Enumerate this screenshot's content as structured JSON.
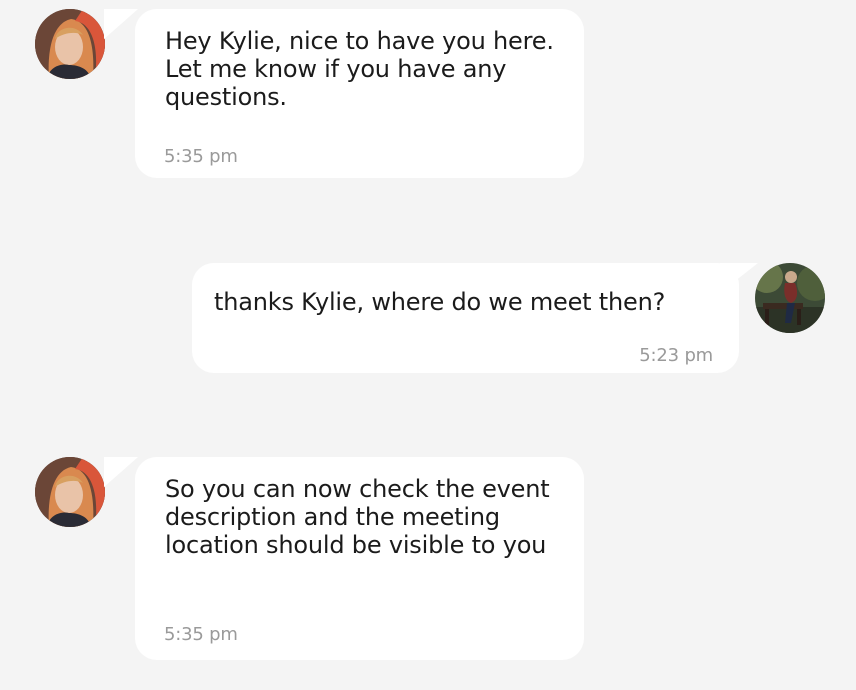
{
  "messages": [
    {
      "sender": "them",
      "text": "Hey Kylie, nice to have you here. Let me know if you have any questions.",
      "time": "5:35 pm",
      "avatar": "woman-portrait-avatar"
    },
    {
      "sender": "me",
      "text": "thanks Kylie, where do we meet then?",
      "time": "5:23 pm",
      "avatar": "person-on-bench-avatar"
    },
    {
      "sender": "them",
      "text": "So you can now check the event description and the meeting location should be visible to you",
      "time": "5:35 pm",
      "avatar": "woman-portrait-avatar"
    }
  ],
  "colors": {
    "background": "#f4f4f4",
    "bubble": "#ffffff",
    "text": "#1b1b1b",
    "timestamp": "#9a9a9a"
  }
}
